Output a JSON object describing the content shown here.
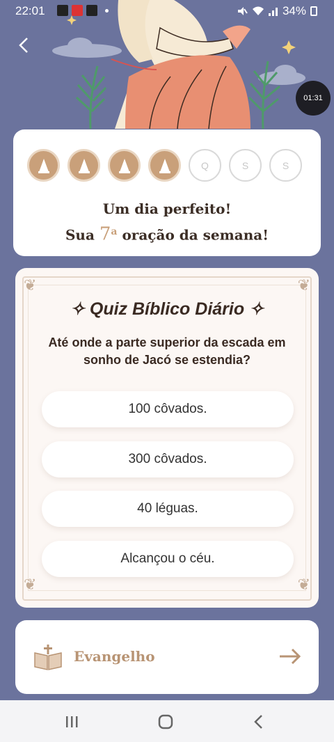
{
  "status_bar": {
    "time": "22:01",
    "battery": "34%"
  },
  "hero": {
    "timer": "01:31"
  },
  "streak": {
    "days": [
      {
        "label": "",
        "done": true
      },
      {
        "label": "",
        "done": true
      },
      {
        "label": "",
        "done": true
      },
      {
        "label": "",
        "done": true
      },
      {
        "label": "Q",
        "done": false
      },
      {
        "label": "S",
        "done": false
      },
      {
        "label": "S",
        "done": false
      }
    ],
    "line1": "Um dia perfeito!",
    "line2_prefix": "Sua",
    "count": "7",
    "ordinal": "a",
    "line2_suffix": "oração da semana!"
  },
  "quiz": {
    "title": "Quiz Bíblico Diário",
    "question": "Até onde a parte superior da escada em sonho de Jacó se estendia?",
    "options": [
      "100 côvados.",
      "300 côvados.",
      "40 léguas.",
      "Alcançou o céu."
    ]
  },
  "gospel": {
    "label": "Evangelho"
  },
  "colors": {
    "accent": "#c9a07a",
    "background": "#6b739d"
  }
}
